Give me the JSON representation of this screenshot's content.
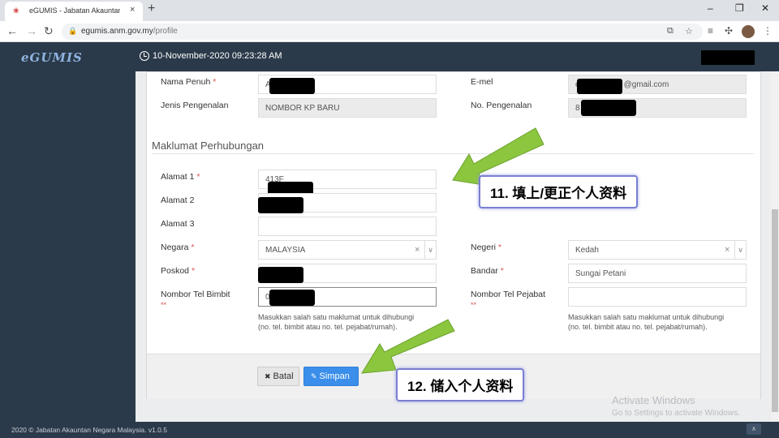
{
  "browser": {
    "tab_title": "eGUMIS - Jabatan Akauntan Neg...",
    "tab_close": "×",
    "new_tab": "+",
    "win_minimize": "–",
    "win_restore": "❐",
    "win_close": "✕",
    "url_host": "egumis.anm.gov.my",
    "url_path": "/profile"
  },
  "app": {
    "logo": "eGUMIS",
    "datetime": "10-November-2020 09:23:28 AM"
  },
  "form": {
    "nama_penuh": {
      "label": "Nama Penuh",
      "required": "*",
      "value": "A"
    },
    "emel": {
      "label": "E-mel",
      "value": "e",
      "value_suffix": "@gmail.com"
    },
    "jenis_pengenalan": {
      "label": "Jenis Pengenalan",
      "value": "NOMBOR KP BARU"
    },
    "no_pengenalan": {
      "label": "No. Pengenalan",
      "value": "8"
    },
    "section_title": "Maklumat Perhubungan",
    "alamat1": {
      "label": "Alamat 1",
      "required": "*",
      "value": "413F"
    },
    "alamat2": {
      "label": "Alamat 2",
      "value": ""
    },
    "alamat3": {
      "label": "Alamat 3",
      "value": ""
    },
    "negara": {
      "label": "Negara",
      "required": "*",
      "value": "MALAYSIA"
    },
    "negeri": {
      "label": "Negeri",
      "required": "*",
      "value": "Kedah"
    },
    "poskod": {
      "label": "Poskod",
      "required": "*",
      "value": ""
    },
    "bandar": {
      "label": "Bandar",
      "required": "*",
      "value": "Sungai Petani"
    },
    "tel_bimbit": {
      "label": "Nombor Tel Bimbit",
      "required": "**",
      "value": "0"
    },
    "tel_pejabat": {
      "label": "Nombor Tel Pejabat",
      "required": "**",
      "value": ""
    },
    "help_text_line1": "Masukkan salah satu maklumat untuk dihubungi",
    "help_text_line2": "(no. tel. bimbit atau no. tel. pejabat/rumah).",
    "clear_symbol": "×",
    "caret_symbol": "∨"
  },
  "buttons": {
    "cancel": "Batal",
    "save": "Simpan"
  },
  "annotations": {
    "step11": "11. 填上/更正个人资料",
    "step12": "12. 储入个人资料",
    "arrow_color": "#8cc63f"
  },
  "footer": {
    "copyright": "2020 © Jabatan Akauntan Negara Malaysia. v1.0.5",
    "up": "∧"
  },
  "watermark": {
    "line1": "Activate Windows",
    "line2": "Go to Settings to activate Windows."
  }
}
